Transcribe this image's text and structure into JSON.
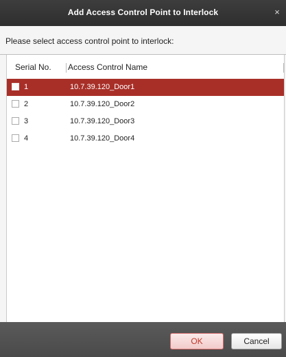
{
  "dialog": {
    "title": "Add Access Control Point to Interlock",
    "close_glyph": "×",
    "prompt": "Please select access control point to interlock:"
  },
  "table": {
    "headers": {
      "serial": "Serial No.",
      "name": "Access Control Name"
    },
    "rows": [
      {
        "serial": "1",
        "name": "10.7.39.120_Door1",
        "selected": true,
        "checked": false
      },
      {
        "serial": "2",
        "name": "10.7.39.120_Door2",
        "selected": false,
        "checked": false
      },
      {
        "serial": "3",
        "name": "10.7.39.120_Door3",
        "selected": false,
        "checked": false
      },
      {
        "serial": "4",
        "name": "10.7.39.120_Door4",
        "selected": false,
        "checked": false
      }
    ]
  },
  "buttons": {
    "ok": "OK",
    "cancel": "Cancel"
  },
  "colors": {
    "titlebar": "#333333",
    "selected_row": "#a82f28",
    "footer": "#505050",
    "ok_text": "#c0392b"
  }
}
